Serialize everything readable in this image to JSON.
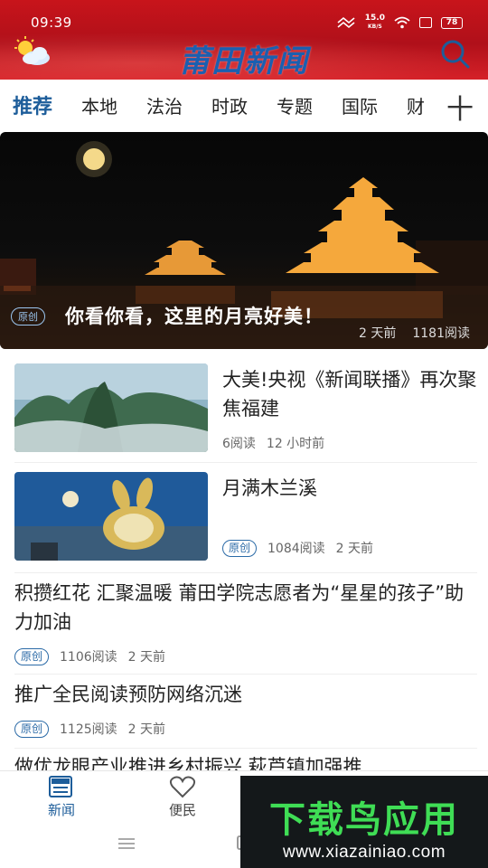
{
  "status_bar": {
    "time": "09:39",
    "speed_value": "15.0",
    "speed_unit": "KB/S",
    "battery": "78"
  },
  "header": {
    "brand": "莆田新闻",
    "weather_icon": "partly-cloudy-icon",
    "search_icon": "search-icon"
  },
  "tabs": {
    "items": [
      {
        "label": "推荐",
        "active": true
      },
      {
        "label": "本地"
      },
      {
        "label": "法治"
      },
      {
        "label": "时政"
      },
      {
        "label": "专题"
      },
      {
        "label": "国际"
      },
      {
        "label": "财"
      }
    ],
    "add_label": "十"
  },
  "hero": {
    "tag": "原创",
    "title": "你看你看，这里的月亮好美！",
    "time": "2 天前",
    "reads": "1181阅读"
  },
  "articles": [
    {
      "title": "大美!央视《新闻联播》再次聚焦福建",
      "reads": "6阅读",
      "time": "12 小时前"
    },
    {
      "title": "月满木兰溪",
      "tag": "原创",
      "reads": "1084阅读",
      "time": "2 天前"
    },
    {
      "title": "积攒红花 汇聚温暖 莆田学院志愿者为“星星的孩子”助力加油",
      "tag": "原创",
      "reads": "1106阅读",
      "time": "2 天前"
    },
    {
      "title": "推广全民阅读预防网络沉迷",
      "tag": "原创",
      "reads": "1125阅读",
      "time": "2 天前"
    }
  ],
  "partial_article": {
    "title": "做优龙眼产业推进乡村振兴 萩芦镇加强推"
  },
  "bottom_nav": {
    "items": [
      {
        "label": "新闻",
        "icon": "news-icon",
        "active": true
      },
      {
        "label": "便民",
        "icon": "heart-icon"
      }
    ]
  },
  "watermark": {
    "text": "下载鸟应用",
    "url": "www.xiazainiao.com"
  },
  "colors": {
    "header_red": "#c8141b",
    "accent_blue": "#1d5d9a",
    "watermark_green": "#3fdd55"
  }
}
